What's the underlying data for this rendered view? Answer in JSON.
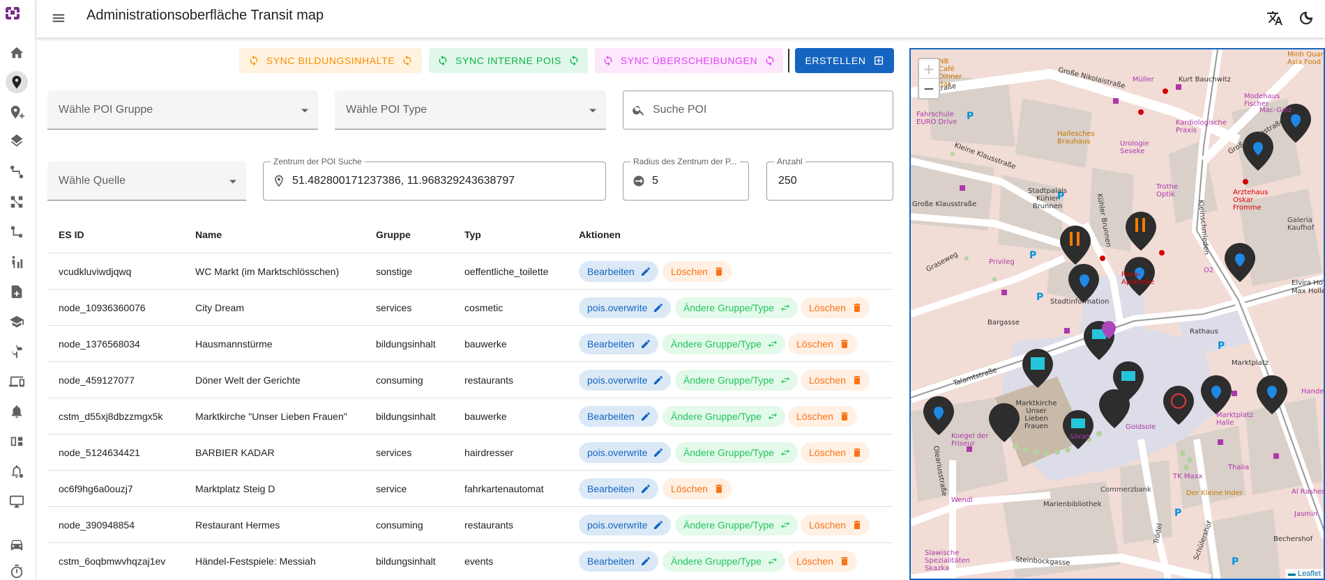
{
  "header": {
    "title": "Administrationsoberfläche Transit map"
  },
  "toolbar": {
    "sync_education": "SYNC BILDUNGSINHALTE",
    "sync_internal": "SYNC INTERNE POIS",
    "sync_overwrites": "SYNC ÜBERSCHEIBUNGEN",
    "create": "ERSTELLEN"
  },
  "filters": {
    "poi_group_placeholder": "Wähle POI Gruppe",
    "poi_type_placeholder": "Wähle POI Type",
    "search_placeholder": "Suche POI",
    "source_placeholder": "Wähle Quelle",
    "center_label": "Zentrum der POI Suche",
    "center_value": "51.482800171237386, 11.968329243638797",
    "radius_label": "Radius des Zentrum der P...",
    "radius_value": "5",
    "count_label": "Anzahl",
    "count_value": "250"
  },
  "table": {
    "headers": [
      "ES ID",
      "Name",
      "Gruppe",
      "Typ",
      "Aktionen"
    ],
    "labels": {
      "edit": "Bearbeiten",
      "overwrite": "pois.overwrite",
      "change": "Ändere Gruppe/Type",
      "delete": "Löschen"
    },
    "rows": [
      {
        "id": "vcudkluviwdjqwq",
        "name": "WC Markt (im Marktschlösschen)",
        "group": "sonstige",
        "type": "oeffentliche_toilette"
      },
      {
        "id": "node_10936360076",
        "name": "City Dream",
        "group": "services",
        "type": "cosmetic"
      },
      {
        "id": "node_1376568034",
        "name": "Hausmannstürme",
        "group": "bildungsinhalt",
        "type": "bauwerke"
      },
      {
        "id": "node_459127077",
        "name": "Döner Welt der Gerichte",
        "group": "consuming",
        "type": "restaurants"
      },
      {
        "id": "cstm_d55xj8dbzzmgx5k",
        "name": "Marktkirche \"Unser Lieben Frauen\"",
        "group": "bildungsinhalt",
        "type": "bauwerke"
      },
      {
        "id": "node_5124634421",
        "name": "BARBIER KADAR",
        "group": "services",
        "type": "hairdresser"
      },
      {
        "id": "oc6f9hg6a0ouzj7",
        "name": "Marktplatz Steig D",
        "group": "service",
        "type": "fahrkartenautomat"
      },
      {
        "id": "node_390948854",
        "name": "Restaurant Hermes",
        "group": "consuming",
        "type": "restaurants"
      },
      {
        "id": "cstm_6oqbmwvhqzaj1ev",
        "name": "Händel-Festspiele: Messiah",
        "group": "bildungsinhalt",
        "type": "events"
      }
    ]
  },
  "map": {
    "zoom_in": "+",
    "zoom_out": "−",
    "attribution": "Leaflet",
    "labels": [
      "Kolaistraße",
      "Große Nikolaistraße",
      "Kleine Klausstraße",
      "Große Klausstraße",
      "Stadtpalais Kühler Brunnen",
      "Kühler Brunnen",
      "Graseweg",
      "Privileg",
      "Bargasse",
      "Talamtstraße",
      "Marktkirche Unser Lieben Frauen",
      "Marktplatz",
      "Commerzbank",
      "Marienbibliothek",
      "Der Kleine Inder",
      "Goldsole",
      "Söran",
      "Thalia",
      "TK Maxx",
      "Galeria Kaufhof",
      "Steinbockgasse",
      "Oleariusstraße",
      "Schülershof",
      "Trödel",
      "Bechershof",
      "Slawische Spezialitäten Skazka",
      "Fahrschule EURO Drive",
      "Urologie Seseke",
      "Kardiologische Praxis",
      "Hallesches Brauhaus",
      "Trothe Optik",
      "Arztehaus Oskar Fromme",
      "Kleinschmieden",
      "Große Steinstraße",
      "Müller",
      "Kurt Bauchwitz",
      "Modehaus Fischer",
      "Mac-Geiz",
      "Minh Quan Asia Food",
      "NB Café Dinner Bar",
      "Rathaus",
      "Stadtinformation",
      "Elvira Hof",
      "Max Holle",
      "Marktplatz Halle",
      "Handel",
      "Koegel der Friseur",
      "Wendl",
      "Jasmin",
      "Al Rasheda",
      "Rosa-Apotheke",
      "O2"
    ]
  }
}
